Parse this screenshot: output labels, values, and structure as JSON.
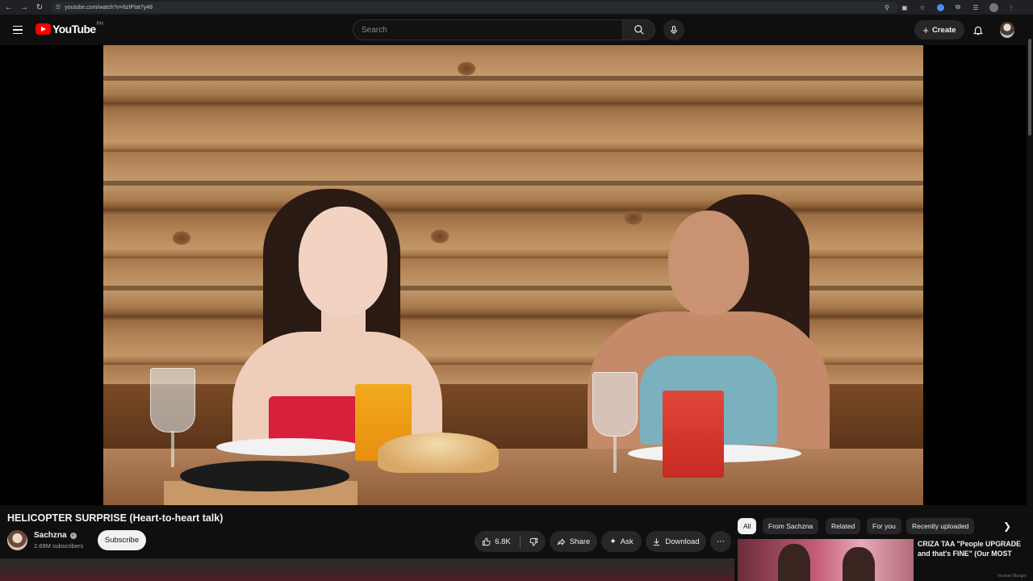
{
  "browser": {
    "url": "youtube.com/watch?v=6zIPIat7y48"
  },
  "header": {
    "logo_text": "YouTube",
    "region": "PH",
    "search_placeholder": "Search",
    "create_label": "Create"
  },
  "video": {
    "title": "HELICOPTER SURPRISE (Heart-to-heart talk)"
  },
  "channel": {
    "name": "Sachzna",
    "subscribers": "2.68M subscribers",
    "subscribe_label": "Subscribe"
  },
  "actions": {
    "likes": "6.8K",
    "share_label": "Share",
    "ask_label": "Ask",
    "download_label": "Download"
  },
  "chips": [
    "All",
    "From Sachzna",
    "Related",
    "For you",
    "Recently uploaded"
  ],
  "recommendation": {
    "title": "CRIZA TAA \"People UPGRADE and that's FINE\" (Our MOST"
  },
  "status_corner": "Normal (Range)",
  "icons": {
    "back": "arrow-left-icon",
    "forward": "arrow-right-icon",
    "reload": "reload-icon",
    "menu": "hamburger-menu-icon",
    "search": "search-icon",
    "mic": "microphone-icon",
    "bell": "bell-icon",
    "like": "thumbs-up-icon",
    "dislike": "thumbs-down-icon",
    "share": "share-arrow-icon",
    "ask": "sparkle-icon",
    "download": "download-icon",
    "more": "more-horizontal-icon"
  },
  "colors": {
    "background": "#0f0f0f",
    "brand_red": "#ff0000",
    "pill_bg": "#272727",
    "text_primary": "#f1f1f1",
    "text_secondary": "#aaaaaa"
  }
}
